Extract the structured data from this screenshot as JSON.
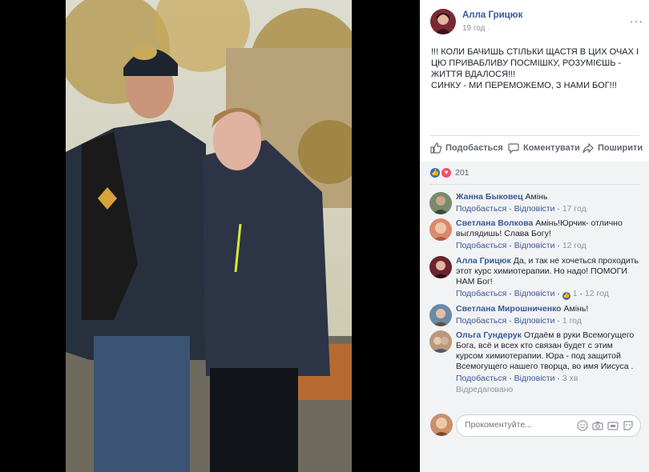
{
  "post": {
    "author": "Алла Грицюк",
    "time": "19 год",
    "text_lines": [
      "!!! КОЛИ БАЧИШЬ СТІЛЬКИ ЩАСТЯ В ЦИХ ОЧАХ І",
      "ЦЮ ПРИВАБЛИВУ ПОСМІШКУ, РОЗУМІЄШЬ -",
      "ЖИТТЯ ВДАЛОСЯ!!!",
      "СИНКУ - МИ ПЕРЕМОЖЕМО, З НАМИ БОГ!!!"
    ]
  },
  "actions": {
    "like": "Подобається",
    "comment": "Коментувати",
    "share": "Поширити"
  },
  "reactions": {
    "count": "201"
  },
  "comments": [
    {
      "author": "Жанна Быковец",
      "text": "Амінь",
      "like": "Подобається",
      "reply": "Відповісти",
      "time": "17 год",
      "avatar_color": "#7a8a6a"
    },
    {
      "author": "Светлана Волкова",
      "text": "Амінь!Юрчик- отлично выглядишь! Слава Богу!",
      "like": "Подобається",
      "reply": "Відповісти",
      "time": "12 год",
      "avatar_color": "#d98a6a"
    },
    {
      "author": "Алла Грицюк",
      "text": "Да, и так не хочеться проходить этот курс химиотерапии. Но надо! ПОМОГИ НАМ Бог!",
      "like": "Подобається",
      "reply": "Відповісти",
      "reaction_count": "1",
      "time": "12 год",
      "avatar_color": "#6a2430"
    },
    {
      "author": "Светлана Мирошниченко",
      "text": "Амінь!",
      "like": "Подобається",
      "reply": "Відповісти",
      "time": "1 год",
      "avatar_color": "#6a8aa8"
    },
    {
      "author": "Ольга Гундерук",
      "text": "Отдаём в руки Всемогущего Бога, всё и всех кто связан будет с этим курсом химиотерапии. Юра - под защитой Всемогущего нашего творца, во имя Иисуса .",
      "like": "Подобається",
      "reply": "Відповісти",
      "time": "3 хв",
      "edited": "Відредаговано",
      "avatar_color": "#b89a7a"
    }
  ],
  "composer": {
    "placeholder": "Прокоментуйте..."
  },
  "colors": {
    "link": "#385898",
    "muted": "#90949c",
    "like_blue": "#4267b2",
    "heart_red": "#f25268"
  },
  "icons": [
    "thumbs-up-icon",
    "comment-icon",
    "share-icon",
    "like-reaction-icon",
    "love-reaction-icon",
    "more-options-icon",
    "emoji-icon",
    "camera-icon",
    "gif-icon",
    "sticker-icon"
  ]
}
